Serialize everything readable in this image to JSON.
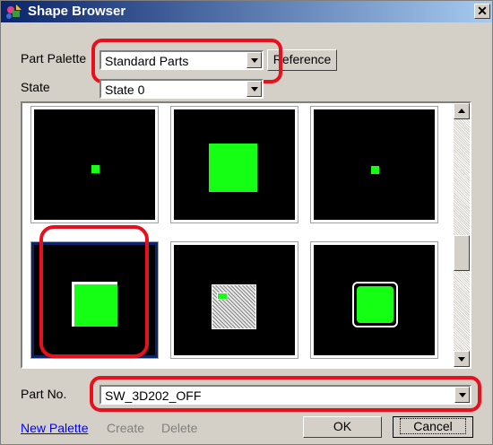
{
  "window": {
    "title": "Shape Browser",
    "close_glyph": "✕"
  },
  "part_palette": {
    "label": "Part Palette",
    "value": "Standard Parts",
    "reference_button": "Reference"
  },
  "state": {
    "label": "State",
    "value": "State 0"
  },
  "part_no": {
    "label": "Part No.",
    "value": "SW_3D202_OFF"
  },
  "footer": {
    "new_palette": "New Palette",
    "create": "Create",
    "delete": "Delete",
    "ok": "OK",
    "cancel": "Cancel"
  },
  "colors": {
    "part_green": "#14ff14",
    "highlight_red": "#e8101c",
    "link_blue": "#0000ff",
    "disabled_text": "#808080"
  },
  "thumbnails": [
    {
      "name": "small-green-square-part"
    },
    {
      "name": "large-green-square-part"
    },
    {
      "name": "small-green-square-part-2"
    },
    {
      "name": "sw-3d202-off-part",
      "selected": true
    },
    {
      "name": "dithered-switch-part"
    },
    {
      "name": "rounded-green-button-part"
    }
  ]
}
